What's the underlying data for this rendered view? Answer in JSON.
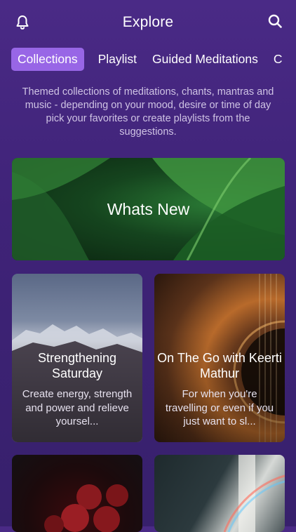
{
  "header": {
    "title": "Explore",
    "bell_icon": "bell-icon",
    "search_icon": "search-icon"
  },
  "tabs": [
    {
      "label": "Collections",
      "active": true
    },
    {
      "label": "Playlist",
      "active": false
    },
    {
      "label": "Guided Meditations",
      "active": false
    },
    {
      "label": "C",
      "active": false
    }
  ],
  "intro": "Themed collections of meditations, chants, mantras and music - depending on your mood, desire or time of day pick your favorites or create playlists from the suggestions.",
  "cards": {
    "whats_new": {
      "title": "Whats New"
    },
    "strengthening": {
      "title": "Strengthening Saturday",
      "desc": "Create energy, strength and power and relieve yoursel..."
    },
    "on_the_go": {
      "title": "On The Go with Keerti Mathur",
      "desc": "For when you're travelling or even if you just want to sl..."
    },
    "roses": {},
    "light": {}
  },
  "colors": {
    "background": "#3f2378",
    "active_tab": "#9866e6",
    "intro_text": "#cfc3e4"
  }
}
